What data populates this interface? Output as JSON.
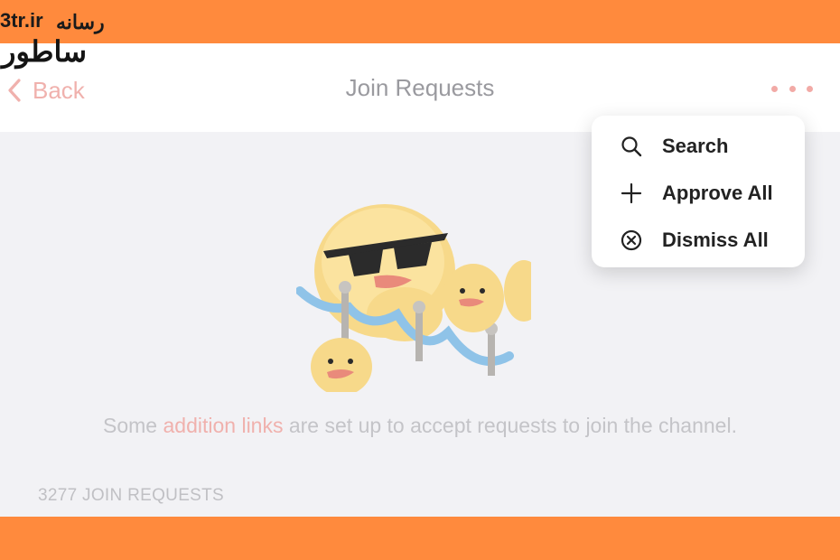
{
  "watermark": {
    "domain": "3tr.ir",
    "line1": "رسانه",
    "line2": "ساطور"
  },
  "header": {
    "back_label": "Back",
    "title": "Join Requests",
    "more_icon": "more-dots-icon"
  },
  "menu": {
    "items": [
      {
        "label": "Search",
        "icon": "search-icon"
      },
      {
        "label": "Approve All",
        "icon": "plus-icon"
      },
      {
        "label": "Dismiss All",
        "icon": "circle-x-icon"
      }
    ]
  },
  "content": {
    "info_before": "Some ",
    "info_link": "addition links",
    "info_after": " are set up to accept requests to join the channel.",
    "count_label": "3277 JOIN REQUESTS"
  },
  "colors": {
    "frame": "#ff8a3d",
    "accent_link": "#f0b1ad",
    "background": "#f2f2f5"
  }
}
